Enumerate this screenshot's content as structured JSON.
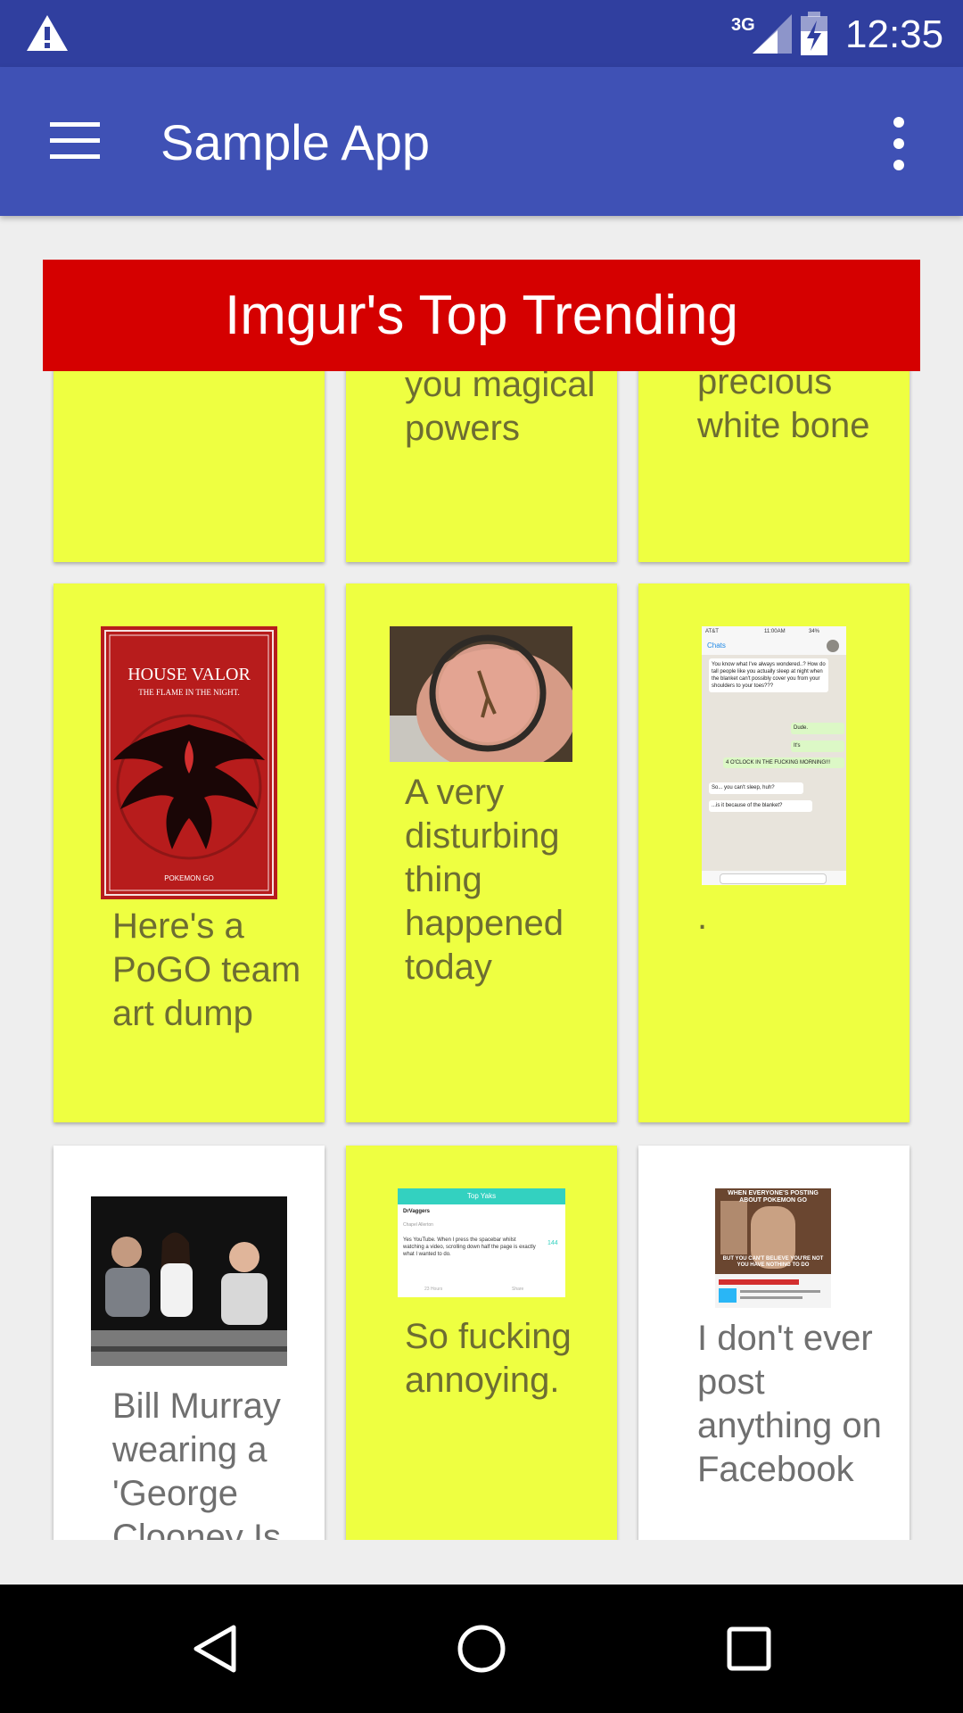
{
  "status_bar": {
    "time": "12:35",
    "network": "3G"
  },
  "app_bar": {
    "title": "Sample App"
  },
  "banner": {
    "title": "Imgur's Top Trending"
  },
  "cards": [
    {
      "text": "",
      "style": "yellow"
    },
    {
      "text": "you magical powers",
      "style": "yellow"
    },
    {
      "text": "precious white bone",
      "style": "yellow"
    },
    {
      "text": "Here's a PoGO team art dump",
      "style": "yellow",
      "image_label": "HOUSE VALOR",
      "image_sub": "THE FLAME IN THE NIGHT.",
      "image_foot": "POKEMON GO"
    },
    {
      "text": "A very disturbing thing happened today",
      "style": "yellow"
    },
    {
      "text": ".",
      "style": "yellow"
    },
    {
      "text": "Bill Murray wearing a 'George Clooney Is",
      "style": "white"
    },
    {
      "text": "So fucking annoying.",
      "style": "yellow"
    },
    {
      "text": "I don't ever post anything on Facebook",
      "style": "white"
    }
  ],
  "chat_screenshot": {
    "carrier": "AT&T",
    "time": "11:00AM",
    "battery": "34%",
    "back": "Chats",
    "messages": [
      "You know what I've always wondered..? How do tall people like you actually sleep at night when the blanket can't possibly cover you from your shoulders to your toes???",
      "Dude.",
      "It's",
      "4 O'CLOCK IN THE FUCKING MORNING!!!",
      "So... you can't sleep, huh?",
      "...is it because of the blanket?"
    ]
  },
  "yak_screenshot": {
    "header": "Top Yaks",
    "user": "DrVaggers",
    "place": "Chapel Allerton",
    "body": "Yes YouTube. When I press the spacebar whilst watching a video, scrolling down half the page is exactly what I wanted to do.",
    "votes": "144",
    "age": "23 Hours",
    "share": "Share"
  },
  "meme": {
    "top": "WHEN EVERYONE'S POSTING ABOUT POKEMON GO",
    "bottom": "BUT YOU CAN'T BELIEVE YOU'RE NOT YOU HAVE NOTHING TO DO"
  },
  "colors": {
    "status_bar": "#303F9F",
    "app_bar": "#3F51B5",
    "banner": "#D50000",
    "card_yellow": "#EEFF41",
    "card_white": "#FFFFFF"
  },
  "icons": {
    "warning": "warning-icon",
    "signal": "signal-icon",
    "battery": "battery-icon",
    "menu": "menu-icon",
    "overflow": "more-vert-icon",
    "back": "back-icon",
    "home": "home-icon",
    "recents": "recents-icon"
  }
}
